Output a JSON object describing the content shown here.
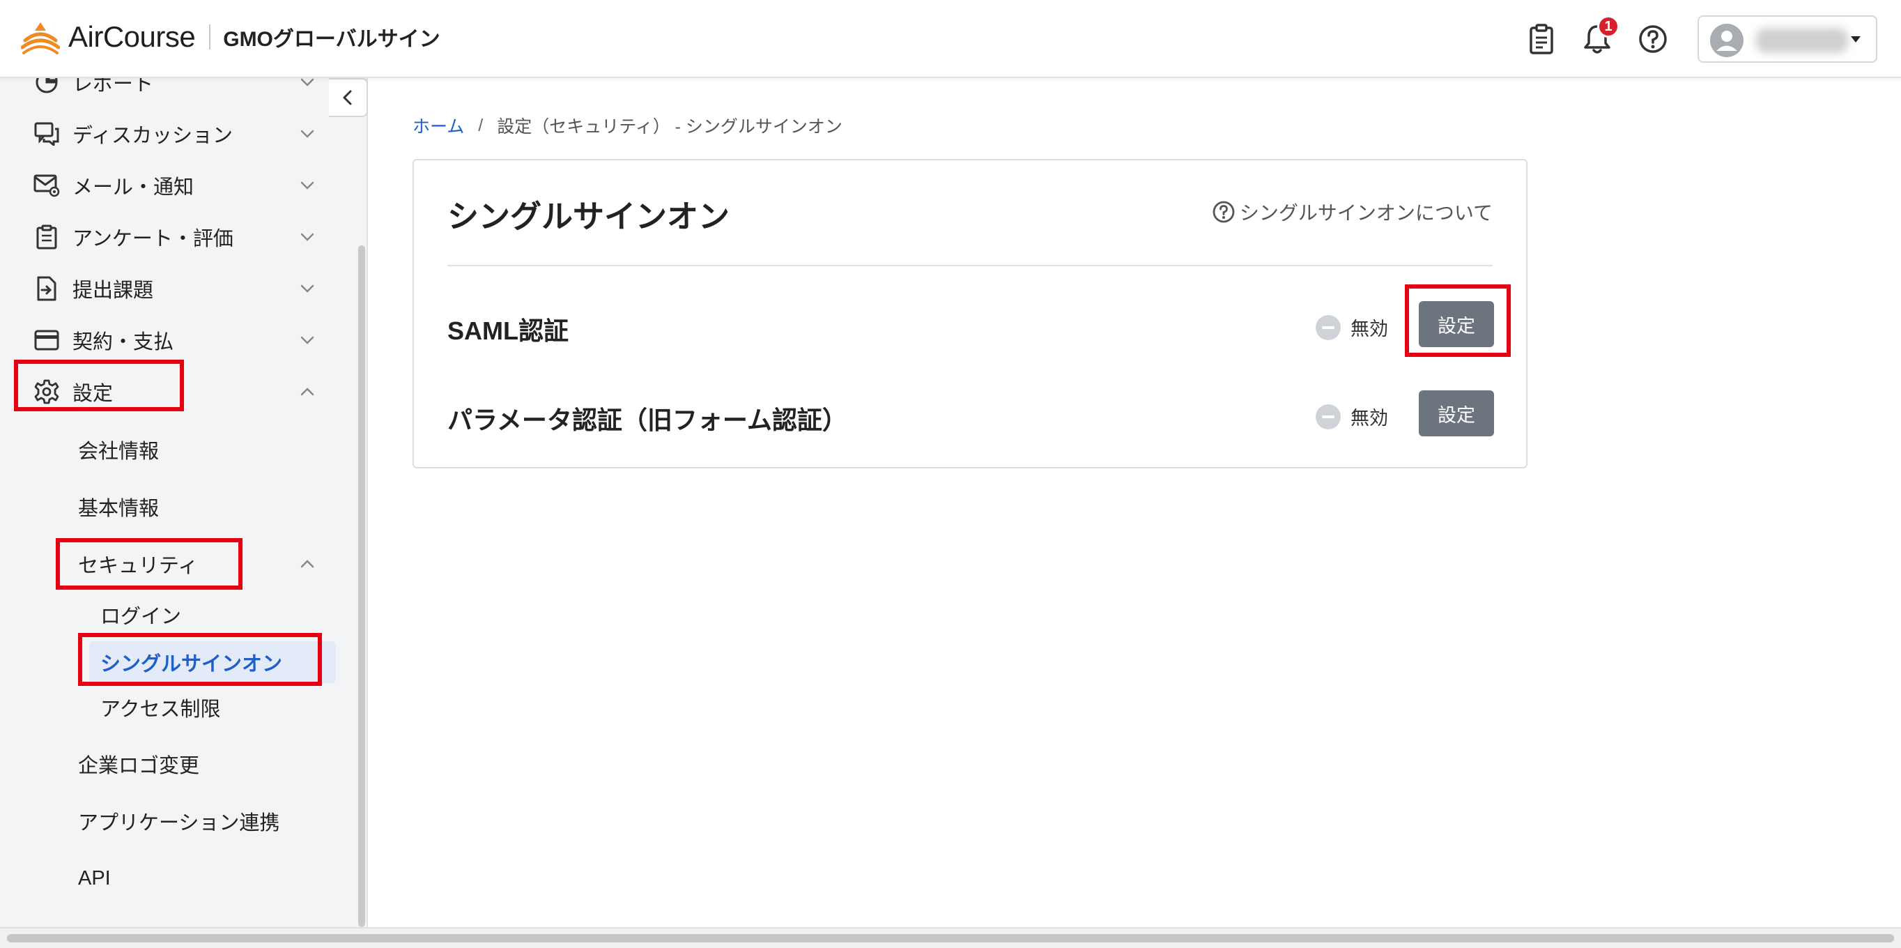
{
  "header": {
    "brand_name": "AirCourse",
    "org_name": "GMOグローバルサイン",
    "notification_count": "1",
    "accent_orange": "#f08a24",
    "icons": [
      "clipboard-icon",
      "bell-icon",
      "help-circle-icon",
      "user-avatar-icon",
      "caret-down-icon"
    ]
  },
  "sidebar": {
    "items": [
      {
        "label": "レポート",
        "icon": "report-icon"
      },
      {
        "label": "ディスカッション",
        "icon": "discussion-icon"
      },
      {
        "label": "メール・通知",
        "icon": "mail-settings-icon"
      },
      {
        "label": "アンケート・評価",
        "icon": "survey-icon"
      },
      {
        "label": "提出課題",
        "icon": "submission-icon"
      },
      {
        "label": "契約・支払",
        "icon": "credit-card-icon"
      },
      {
        "label": "設定",
        "icon": "gear-icon"
      }
    ],
    "settings_sub": [
      {
        "label": "会社情報"
      },
      {
        "label": "基本情報"
      },
      {
        "label": "セキュリティ"
      },
      {
        "label": "企業ロゴ変更"
      },
      {
        "label": "アプリケーション連携"
      },
      {
        "label": "API"
      }
    ],
    "security_sub": [
      {
        "label": "ログイン"
      },
      {
        "label": "シングルサインオン"
      },
      {
        "label": "アクセス制限"
      }
    ],
    "active_color": "#1e5fc9",
    "highlight_color": "#e60012"
  },
  "breadcrumb": {
    "home": "ホーム",
    "separator": "/",
    "current": "設定（セキュリティ） - シングルサインオン"
  },
  "card": {
    "title": "シングルサインオン",
    "help_link": "シングルサインオンについて",
    "rows": [
      {
        "name": "SAML認証",
        "status": "無効",
        "button": "設定"
      },
      {
        "name": "パラメータ認証（旧フォーム認証）",
        "status": "無効",
        "button": "設定"
      }
    ]
  }
}
